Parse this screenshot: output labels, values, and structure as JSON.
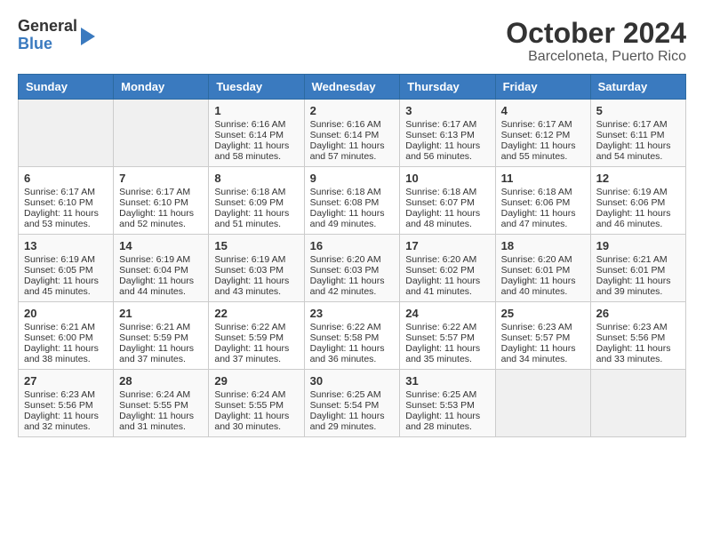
{
  "header": {
    "logo_line1": "General",
    "logo_line2": "Blue",
    "title": "October 2024",
    "subtitle": "Barceloneta, Puerto Rico"
  },
  "weekdays": [
    "Sunday",
    "Monday",
    "Tuesday",
    "Wednesday",
    "Thursday",
    "Friday",
    "Saturday"
  ],
  "weeks": [
    [
      {
        "day": "",
        "empty": true
      },
      {
        "day": "",
        "empty": true
      },
      {
        "day": "1",
        "sunrise": "Sunrise: 6:16 AM",
        "sunset": "Sunset: 6:14 PM",
        "daylight": "Daylight: 11 hours and 58 minutes."
      },
      {
        "day": "2",
        "sunrise": "Sunrise: 6:16 AM",
        "sunset": "Sunset: 6:14 PM",
        "daylight": "Daylight: 11 hours and 57 minutes."
      },
      {
        "day": "3",
        "sunrise": "Sunrise: 6:17 AM",
        "sunset": "Sunset: 6:13 PM",
        "daylight": "Daylight: 11 hours and 56 minutes."
      },
      {
        "day": "4",
        "sunrise": "Sunrise: 6:17 AM",
        "sunset": "Sunset: 6:12 PM",
        "daylight": "Daylight: 11 hours and 55 minutes."
      },
      {
        "day": "5",
        "sunrise": "Sunrise: 6:17 AM",
        "sunset": "Sunset: 6:11 PM",
        "daylight": "Daylight: 11 hours and 54 minutes."
      }
    ],
    [
      {
        "day": "6",
        "sunrise": "Sunrise: 6:17 AM",
        "sunset": "Sunset: 6:10 PM",
        "daylight": "Daylight: 11 hours and 53 minutes."
      },
      {
        "day": "7",
        "sunrise": "Sunrise: 6:17 AM",
        "sunset": "Sunset: 6:10 PM",
        "daylight": "Daylight: 11 hours and 52 minutes."
      },
      {
        "day": "8",
        "sunrise": "Sunrise: 6:18 AM",
        "sunset": "Sunset: 6:09 PM",
        "daylight": "Daylight: 11 hours and 51 minutes."
      },
      {
        "day": "9",
        "sunrise": "Sunrise: 6:18 AM",
        "sunset": "Sunset: 6:08 PM",
        "daylight": "Daylight: 11 hours and 49 minutes."
      },
      {
        "day": "10",
        "sunrise": "Sunrise: 6:18 AM",
        "sunset": "Sunset: 6:07 PM",
        "daylight": "Daylight: 11 hours and 48 minutes."
      },
      {
        "day": "11",
        "sunrise": "Sunrise: 6:18 AM",
        "sunset": "Sunset: 6:06 PM",
        "daylight": "Daylight: 11 hours and 47 minutes."
      },
      {
        "day": "12",
        "sunrise": "Sunrise: 6:19 AM",
        "sunset": "Sunset: 6:06 PM",
        "daylight": "Daylight: 11 hours and 46 minutes."
      }
    ],
    [
      {
        "day": "13",
        "sunrise": "Sunrise: 6:19 AM",
        "sunset": "Sunset: 6:05 PM",
        "daylight": "Daylight: 11 hours and 45 minutes."
      },
      {
        "day": "14",
        "sunrise": "Sunrise: 6:19 AM",
        "sunset": "Sunset: 6:04 PM",
        "daylight": "Daylight: 11 hours and 44 minutes."
      },
      {
        "day": "15",
        "sunrise": "Sunrise: 6:19 AM",
        "sunset": "Sunset: 6:03 PM",
        "daylight": "Daylight: 11 hours and 43 minutes."
      },
      {
        "day": "16",
        "sunrise": "Sunrise: 6:20 AM",
        "sunset": "Sunset: 6:03 PM",
        "daylight": "Daylight: 11 hours and 42 minutes."
      },
      {
        "day": "17",
        "sunrise": "Sunrise: 6:20 AM",
        "sunset": "Sunset: 6:02 PM",
        "daylight": "Daylight: 11 hours and 41 minutes."
      },
      {
        "day": "18",
        "sunrise": "Sunrise: 6:20 AM",
        "sunset": "Sunset: 6:01 PM",
        "daylight": "Daylight: 11 hours and 40 minutes."
      },
      {
        "day": "19",
        "sunrise": "Sunrise: 6:21 AM",
        "sunset": "Sunset: 6:01 PM",
        "daylight": "Daylight: 11 hours and 39 minutes."
      }
    ],
    [
      {
        "day": "20",
        "sunrise": "Sunrise: 6:21 AM",
        "sunset": "Sunset: 6:00 PM",
        "daylight": "Daylight: 11 hours and 38 minutes."
      },
      {
        "day": "21",
        "sunrise": "Sunrise: 6:21 AM",
        "sunset": "Sunset: 5:59 PM",
        "daylight": "Daylight: 11 hours and 37 minutes."
      },
      {
        "day": "22",
        "sunrise": "Sunrise: 6:22 AM",
        "sunset": "Sunset: 5:59 PM",
        "daylight": "Daylight: 11 hours and 37 minutes."
      },
      {
        "day": "23",
        "sunrise": "Sunrise: 6:22 AM",
        "sunset": "Sunset: 5:58 PM",
        "daylight": "Daylight: 11 hours and 36 minutes."
      },
      {
        "day": "24",
        "sunrise": "Sunrise: 6:22 AM",
        "sunset": "Sunset: 5:57 PM",
        "daylight": "Daylight: 11 hours and 35 minutes."
      },
      {
        "day": "25",
        "sunrise": "Sunrise: 6:23 AM",
        "sunset": "Sunset: 5:57 PM",
        "daylight": "Daylight: 11 hours and 34 minutes."
      },
      {
        "day": "26",
        "sunrise": "Sunrise: 6:23 AM",
        "sunset": "Sunset: 5:56 PM",
        "daylight": "Daylight: 11 hours and 33 minutes."
      }
    ],
    [
      {
        "day": "27",
        "sunrise": "Sunrise: 6:23 AM",
        "sunset": "Sunset: 5:56 PM",
        "daylight": "Daylight: 11 hours and 32 minutes."
      },
      {
        "day": "28",
        "sunrise": "Sunrise: 6:24 AM",
        "sunset": "Sunset: 5:55 PM",
        "daylight": "Daylight: 11 hours and 31 minutes."
      },
      {
        "day": "29",
        "sunrise": "Sunrise: 6:24 AM",
        "sunset": "Sunset: 5:55 PM",
        "daylight": "Daylight: 11 hours and 30 minutes."
      },
      {
        "day": "30",
        "sunrise": "Sunrise: 6:25 AM",
        "sunset": "Sunset: 5:54 PM",
        "daylight": "Daylight: 11 hours and 29 minutes."
      },
      {
        "day": "31",
        "sunrise": "Sunrise: 6:25 AM",
        "sunset": "Sunset: 5:53 PM",
        "daylight": "Daylight: 11 hours and 28 minutes."
      },
      {
        "day": "",
        "empty": true
      },
      {
        "day": "",
        "empty": true
      }
    ]
  ]
}
